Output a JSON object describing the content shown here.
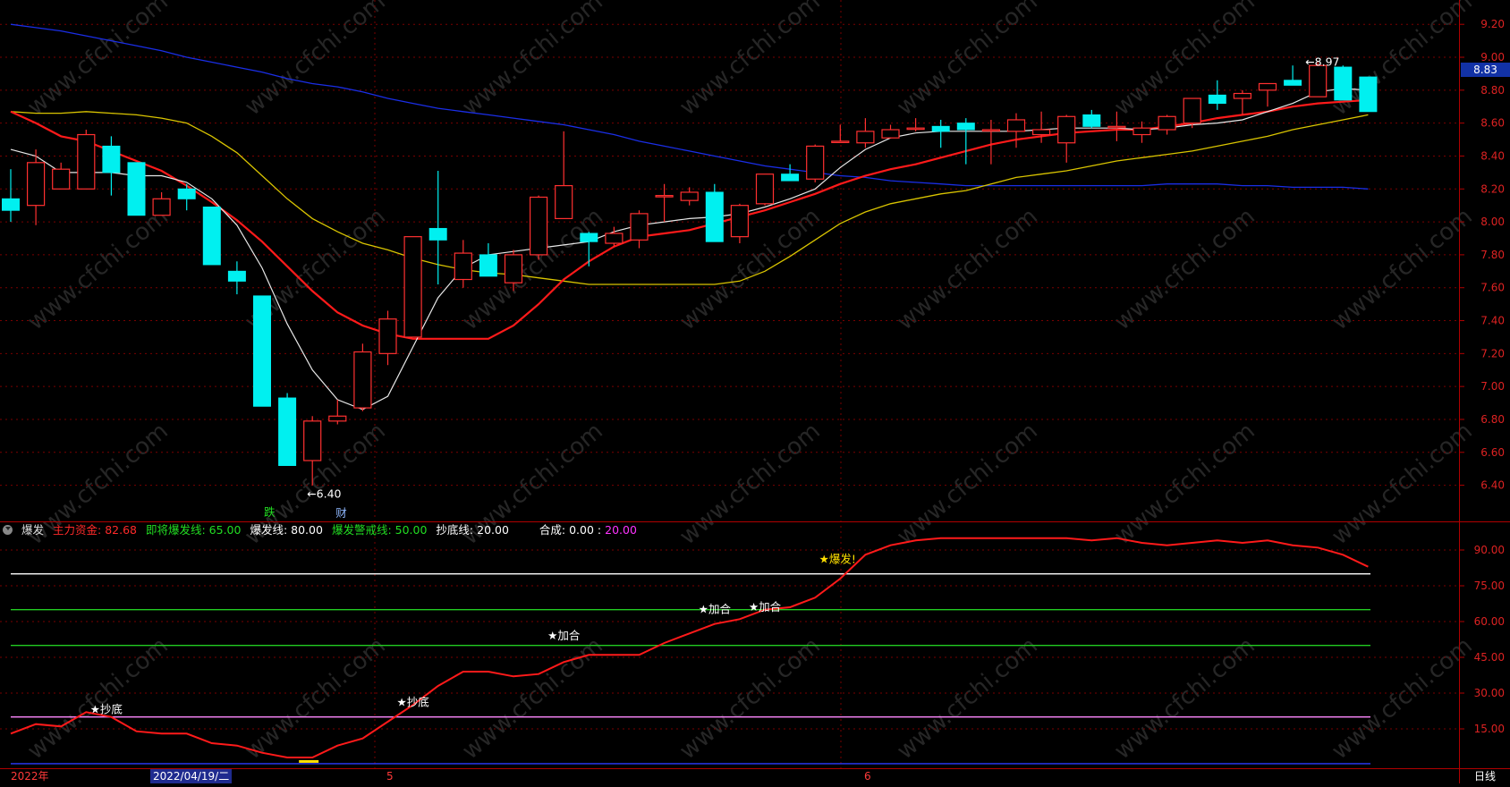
{
  "chart_data": [
    {
      "type": "candlestick",
      "y_ticks": [
        "9.20",
        "9.00",
        "8.80",
        "8.60",
        "8.40",
        "8.20",
        "8.00",
        "7.80",
        "7.60",
        "7.40",
        "7.20",
        "7.00",
        "6.80",
        "6.60",
        "6.40"
      ],
      "ylim": [
        6.3,
        9.25
      ],
      "annotations": {
        "high_mark": "8.97",
        "low_mark": "6.40",
        "last_price": "8.83",
        "signal_1": "跌",
        "signal_2": "财"
      },
      "candles": [
        {
          "o": 8.14,
          "h": 8.32,
          "l": 8.0,
          "c": 8.07
        },
        {
          "o": 8.1,
          "h": 8.44,
          "l": 7.98,
          "c": 8.36
        },
        {
          "o": 8.2,
          "h": 8.36,
          "l": 8.2,
          "c": 8.32
        },
        {
          "o": 8.2,
          "h": 8.56,
          "l": 8.2,
          "c": 8.53
        },
        {
          "o": 8.46,
          "h": 8.52,
          "l": 8.16,
          "c": 8.3
        },
        {
          "o": 8.36,
          "h": 8.36,
          "l": 8.04,
          "c": 8.04
        },
        {
          "o": 8.04,
          "h": 8.18,
          "l": 8.04,
          "c": 8.14
        },
        {
          "o": 8.2,
          "h": 8.23,
          "l": 8.07,
          "c": 8.14
        },
        {
          "o": 8.09,
          "h": 8.09,
          "l": 7.74,
          "c": 7.74
        },
        {
          "o": 7.7,
          "h": 7.76,
          "l": 7.56,
          "c": 7.64
        },
        {
          "o": 7.55,
          "h": 7.55,
          "l": 6.88,
          "c": 6.88
        },
        {
          "o": 6.93,
          "h": 6.96,
          "l": 6.52,
          "c": 6.52
        },
        {
          "o": 6.55,
          "h": 6.82,
          "l": 6.4,
          "c": 6.79
        },
        {
          "o": 6.79,
          "h": 6.92,
          "l": 6.77,
          "c": 6.82
        },
        {
          "o": 6.87,
          "h": 7.26,
          "l": 6.85,
          "c": 7.21
        },
        {
          "o": 7.2,
          "h": 7.46,
          "l": 7.13,
          "c": 7.41
        },
        {
          "o": 7.3,
          "h": 7.91,
          "l": 7.3,
          "c": 7.91
        },
        {
          "o": 7.96,
          "h": 8.31,
          "l": 7.62,
          "c": 7.89
        },
        {
          "o": 7.65,
          "h": 7.89,
          "l": 7.6,
          "c": 7.81
        },
        {
          "o": 7.8,
          "h": 7.87,
          "l": 7.67,
          "c": 7.67
        },
        {
          "o": 7.63,
          "h": 7.83,
          "l": 7.58,
          "c": 7.8
        },
        {
          "o": 7.8,
          "h": 8.16,
          "l": 7.77,
          "c": 8.15
        },
        {
          "o": 8.02,
          "h": 8.55,
          "l": 8.02,
          "c": 8.22
        },
        {
          "o": 7.93,
          "h": 7.94,
          "l": 7.73,
          "c": 7.88
        },
        {
          "o": 7.87,
          "h": 7.97,
          "l": 7.85,
          "c": 7.93
        },
        {
          "o": 7.89,
          "h": 8.07,
          "l": 7.84,
          "c": 8.05
        },
        {
          "o": 8.16,
          "h": 8.23,
          "l": 8.0,
          "c": 8.16
        },
        {
          "o": 8.13,
          "h": 8.21,
          "l": 8.1,
          "c": 8.18
        },
        {
          "o": 8.18,
          "h": 8.23,
          "l": 7.88,
          "c": 7.88
        },
        {
          "o": 7.91,
          "h": 8.11,
          "l": 7.87,
          "c": 8.1
        },
        {
          "o": 8.11,
          "h": 8.29,
          "l": 8.1,
          "c": 8.29
        },
        {
          "o": 8.29,
          "h": 8.35,
          "l": 8.25,
          "c": 8.25
        },
        {
          "o": 8.26,
          "h": 8.47,
          "l": 8.24,
          "c": 8.46
        },
        {
          "o": 8.49,
          "h": 8.59,
          "l": 8.49,
          "c": 8.49
        },
        {
          "o": 8.48,
          "h": 8.63,
          "l": 8.45,
          "c": 8.55
        },
        {
          "o": 8.51,
          "h": 8.59,
          "l": 8.51,
          "c": 8.56
        },
        {
          "o": 8.57,
          "h": 8.63,
          "l": 8.55,
          "c": 8.57
        },
        {
          "o": 8.58,
          "h": 8.62,
          "l": 8.45,
          "c": 8.55
        },
        {
          "o": 8.6,
          "h": 8.63,
          "l": 8.35,
          "c": 8.56
        },
        {
          "o": 8.56,
          "h": 8.62,
          "l": 8.35,
          "c": 8.56
        },
        {
          "o": 8.55,
          "h": 8.66,
          "l": 8.45,
          "c": 8.62
        },
        {
          "o": 8.53,
          "h": 8.67,
          "l": 8.48,
          "c": 8.56
        },
        {
          "o": 8.48,
          "h": 8.65,
          "l": 8.36,
          "c": 8.64
        },
        {
          "o": 8.65,
          "h": 8.68,
          "l": 8.57,
          "c": 8.58
        },
        {
          "o": 8.58,
          "h": 8.67,
          "l": 8.49,
          "c": 8.58
        },
        {
          "o": 8.53,
          "h": 8.61,
          "l": 8.48,
          "c": 8.57
        },
        {
          "o": 8.56,
          "h": 8.65,
          "l": 8.53,
          "c": 8.64
        },
        {
          "o": 8.6,
          "h": 8.75,
          "l": 8.57,
          "c": 8.75
        },
        {
          "o": 8.77,
          "h": 8.86,
          "l": 8.68,
          "c": 8.72
        },
        {
          "o": 8.75,
          "h": 8.8,
          "l": 8.65,
          "c": 8.78
        },
        {
          "o": 8.8,
          "h": 8.84,
          "l": 8.7,
          "c": 8.84
        },
        {
          "o": 8.86,
          "h": 8.95,
          "l": 8.83,
          "c": 8.83
        },
        {
          "o": 8.76,
          "h": 8.97,
          "l": 8.76,
          "c": 8.95
        },
        {
          "o": 8.94,
          "h": 8.95,
          "l": 8.74,
          "c": 8.74
        },
        {
          "o": 8.88,
          "h": 8.88,
          "l": 8.67,
          "c": 8.67
        }
      ],
      "ma_white": [
        8.44,
        8.4,
        8.3,
        8.3,
        8.3,
        8.28,
        8.28,
        8.24,
        8.14,
        7.98,
        7.72,
        7.38,
        7.1,
        6.92,
        6.86,
        6.94,
        7.24,
        7.54,
        7.72,
        7.8,
        7.82,
        7.84,
        7.86,
        7.88,
        7.94,
        7.98,
        8.0,
        8.02,
        8.03,
        8.05,
        8.09,
        8.14,
        8.2,
        8.33,
        8.44,
        8.51,
        8.54,
        8.55,
        8.55,
        8.55,
        8.55,
        8.56,
        8.57,
        8.57,
        8.57,
        8.56,
        8.57,
        8.59,
        8.6,
        8.62,
        8.67,
        8.72,
        8.79,
        8.81,
        8.8
      ],
      "ma_red": [
        8.67,
        8.6,
        8.52,
        8.49,
        8.43,
        8.37,
        8.31,
        8.22,
        8.12,
        8.01,
        7.88,
        7.73,
        7.58,
        7.45,
        7.37,
        7.32,
        7.29,
        7.29,
        7.29,
        7.29,
        7.37,
        7.5,
        7.65,
        7.76,
        7.85,
        7.91,
        7.93,
        7.95,
        7.99,
        8.03,
        8.07,
        8.12,
        8.17,
        8.23,
        8.28,
        8.32,
        8.35,
        8.39,
        8.43,
        8.47,
        8.5,
        8.52,
        8.54,
        8.55,
        8.56,
        8.56,
        8.58,
        8.6,
        8.63,
        8.65,
        8.67,
        8.7,
        8.72,
        8.73,
        8.74
      ],
      "ma_yellow": [
        8.67,
        8.66,
        8.66,
        8.67,
        8.66,
        8.65,
        8.63,
        8.6,
        8.52,
        8.42,
        8.28,
        8.14,
        8.02,
        7.94,
        7.87,
        7.83,
        7.78,
        7.74,
        7.71,
        7.69,
        7.68,
        7.66,
        7.64,
        7.62,
        7.62,
        7.62,
        7.62,
        7.62,
        7.62,
        7.64,
        7.7,
        7.79,
        7.89,
        7.99,
        8.06,
        8.11,
        8.14,
        8.17,
        8.19,
        8.23,
        8.27,
        8.29,
        8.31,
        8.34,
        8.37,
        8.39,
        8.41,
        8.43,
        8.46,
        8.49,
        8.52,
        8.56,
        8.59,
        8.62,
        8.65
      ],
      "ma_blue": [
        9.2,
        9.18,
        9.16,
        9.13,
        9.1,
        9.07,
        9.04,
        9.0,
        8.97,
        8.94,
        8.91,
        8.87,
        8.84,
        8.82,
        8.79,
        8.75,
        8.72,
        8.69,
        8.67,
        8.65,
        8.63,
        8.61,
        8.59,
        8.56,
        8.53,
        8.49,
        8.46,
        8.43,
        8.4,
        8.37,
        8.34,
        8.32,
        8.3,
        8.28,
        8.27,
        8.25,
        8.24,
        8.23,
        8.22,
        8.22,
        8.22,
        8.22,
        8.22,
        8.22,
        8.22,
        8.22,
        8.23,
        8.23,
        8.23,
        8.22,
        8.22,
        8.21,
        8.21,
        8.21,
        8.2
      ]
    },
    {
      "type": "line",
      "indicator_name": "爆发",
      "y_ticks": [
        "90.00",
        "75.00",
        "60.00",
        "45.00",
        "30.00",
        "15.00"
      ],
      "ylim": [
        0,
        102
      ],
      "legend": [
        {
          "label": "主力资金:",
          "value": "82.68",
          "color": "#ff2a2a"
        },
        {
          "label": "即将爆发线:",
          "value": "65.00",
          "color": "#22dd22"
        },
        {
          "label": "爆发线:",
          "value": "80.00",
          "color": "#ffffff"
        },
        {
          "label": "爆发警戒线:",
          "value": "50.00",
          "color": "#22dd22"
        },
        {
          "label": "抄底线:",
          "value": "20.00",
          "color": "#ffffff"
        },
        {
          "label": "合成:",
          "value": "0.00",
          "value2": "20.00",
          "color": "#ffffff"
        }
      ],
      "hlines": [
        {
          "value": 80,
          "color": "#ffffff"
        },
        {
          "value": 65,
          "color": "#22cc22"
        },
        {
          "value": 50,
          "color": "#22cc22"
        },
        {
          "value": 20,
          "color": "#ff88ff"
        },
        {
          "value": 0.4,
          "color": "#2a3aff"
        }
      ],
      "signals": [
        {
          "index": 3.3,
          "value": 23,
          "text": "★抄底",
          "color": "#ffffff"
        },
        {
          "index": 15.5,
          "value": 26,
          "text": "★抄底",
          "color": "#ffffff"
        },
        {
          "index": 21.5,
          "value": 54,
          "text": "★加合",
          "color": "#ffffff"
        },
        {
          "index": 27.5,
          "value": 65,
          "text": "★加合",
          "color": "#ffffff"
        },
        {
          "index": 29.5,
          "value": 66,
          "text": "★加合",
          "color": "#ffffff"
        },
        {
          "index": 32.3,
          "value": 86,
          "text": "★爆发!",
          "color": "#ffe000"
        }
      ],
      "main_force": [
        13,
        17,
        16,
        22,
        20,
        14,
        13,
        13,
        9,
        8,
        5,
        3,
        3,
        8,
        11,
        18,
        25,
        33,
        39,
        39,
        37,
        38,
        43,
        46,
        46,
        46,
        51,
        55,
        59,
        61,
        65,
        66,
        70,
        78,
        88,
        92,
        94,
        95,
        95,
        95,
        95,
        95,
        95,
        94,
        95,
        93,
        92,
        93,
        94,
        93,
        94,
        92,
        91,
        88,
        83
      ]
    }
  ],
  "x_labels": {
    "start": "2022年",
    "cursor_date": "2022/04/19/二",
    "may": "5",
    "june": "6"
  },
  "period": "日线",
  "watermark": "www.cfchi.com"
}
